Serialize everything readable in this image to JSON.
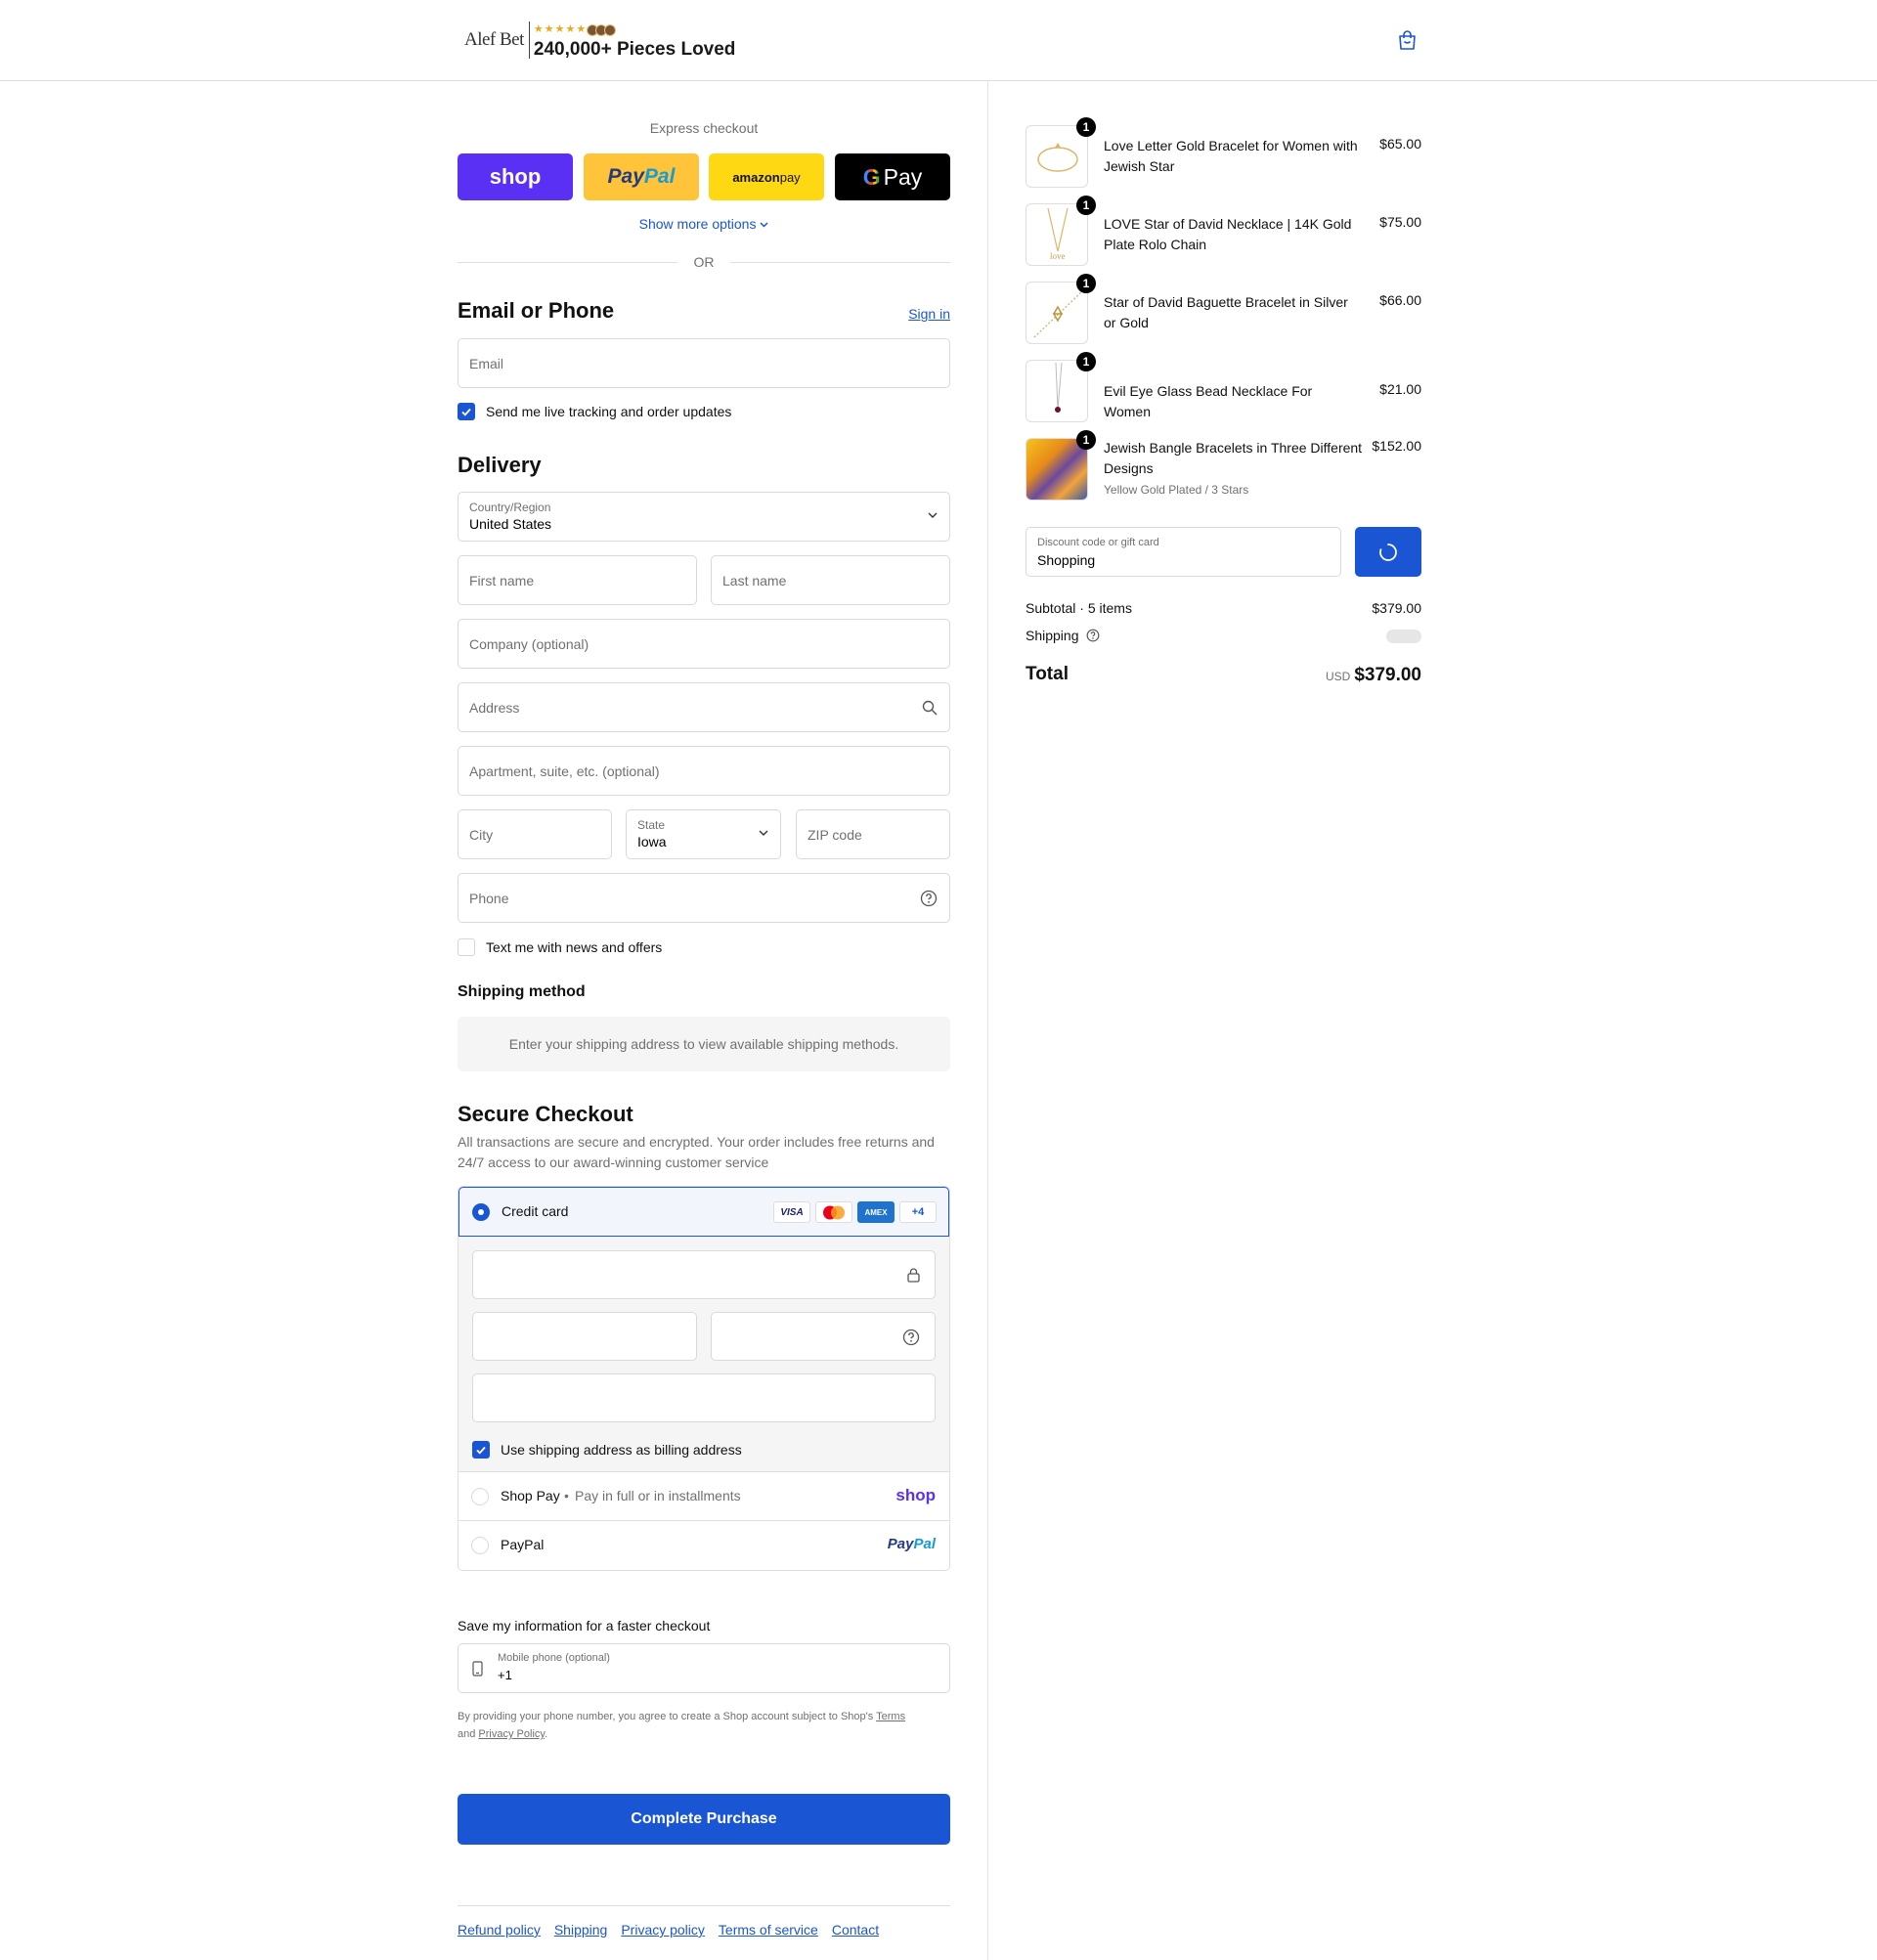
{
  "header": {
    "brand": "Alef Bet",
    "stars": "★★★★★",
    "tagline": "240,000+ Pieces Loved"
  },
  "express": {
    "title": "Express checkout",
    "shop": "shop",
    "paypal_a": "Pay",
    "paypal_b": "Pal",
    "amazon_a": "amazon",
    "amazon_b": " pay",
    "gpay_g": "G",
    "gpay_text": "Pay",
    "show_more": "Show more options",
    "or": "OR"
  },
  "contact": {
    "title": "Email or Phone",
    "sign_in": "Sign in",
    "email_placeholder": "Email",
    "updates_label": "Send me live tracking and order updates",
    "updates_checked": true
  },
  "delivery": {
    "title": "Delivery",
    "country_label": "Country/Region",
    "country_value": "United States",
    "first_name": "First name",
    "last_name": "Last name",
    "company": "Company (optional)",
    "address": "Address",
    "apartment": "Apartment, suite, etc. (optional)",
    "city": "City",
    "state_label": "State",
    "state_value": "Iowa",
    "zip": "ZIP code",
    "phone": "Phone",
    "text_offers": "Text me with news and offers",
    "text_offers_checked": false
  },
  "shipping_method": {
    "title": "Shipping method",
    "message": "Enter your shipping address to view available shipping methods."
  },
  "payment": {
    "title": "Secure Checkout",
    "subtitle": "All transactions are secure and encrypted. Your order includes free returns and 24/7 access to our award-winning customer service",
    "credit_card": "Credit card",
    "brands": [
      "VISA",
      "Mastercard",
      "AMEX",
      "+4"
    ],
    "billing_same": "Use shipping address as billing address",
    "billing_same_checked": true,
    "shop_pay": "Shop Pay",
    "shop_pay_sub": "Pay in full or in installments",
    "shop_logo": "shop",
    "paypal": "PayPal",
    "paypal_logo_a": "Pay",
    "paypal_logo_b": "Pal"
  },
  "save_info": {
    "title": "Save my information for a faster checkout",
    "mobile_label": "Mobile phone (optional)",
    "mobile_value": "+1",
    "legal_pre": "By providing your phone number, you agree to create a Shop account subject to Shop's ",
    "terms": "Terms",
    "legal_and": "and ",
    "privacy": "Privacy Policy",
    "legal_end": "."
  },
  "complete_button": "Complete Purchase",
  "footer_links": [
    "Refund policy",
    "Shipping",
    "Privacy policy",
    "Terms of service",
    "Contact"
  ],
  "order": {
    "items": [
      {
        "name": "Love Letter Gold Bracelet for Women with Jewish Star",
        "price": "$65.00",
        "qty": "1",
        "variant": ""
      },
      {
        "name": "LOVE Star of David Necklace | 14K Gold Plate Rolo Chain",
        "price": "$75.00",
        "qty": "1",
        "variant": ""
      },
      {
        "name": "Star of David Baguette Bracelet in Silver or Gold",
        "price": "$66.00",
        "qty": "1",
        "variant": ""
      },
      {
        "name": "Evil Eye Glass Bead Necklace For Women",
        "price": "$21.00",
        "qty": "1",
        "variant": ""
      },
      {
        "name": "Jewish Bangle Bracelets in Three Different Designs",
        "price": "$152.00",
        "qty": "1",
        "variant": "Yellow Gold Plated / 3 Stars"
      }
    ],
    "discount_label": "Discount code or gift card",
    "discount_value": "Shopping",
    "subtotal_label": "Subtotal · 5 items",
    "subtotal_value": "$379.00",
    "shipping_label": "Shipping",
    "total_label": "Total",
    "currency": "USD",
    "total_value": "$379.00"
  },
  "colors": {
    "accent": "#1a55d4",
    "shop_purple": "#5a31f4",
    "paypal_yellow": "#ffc439",
    "amazon_yellow": "#ffd814"
  }
}
